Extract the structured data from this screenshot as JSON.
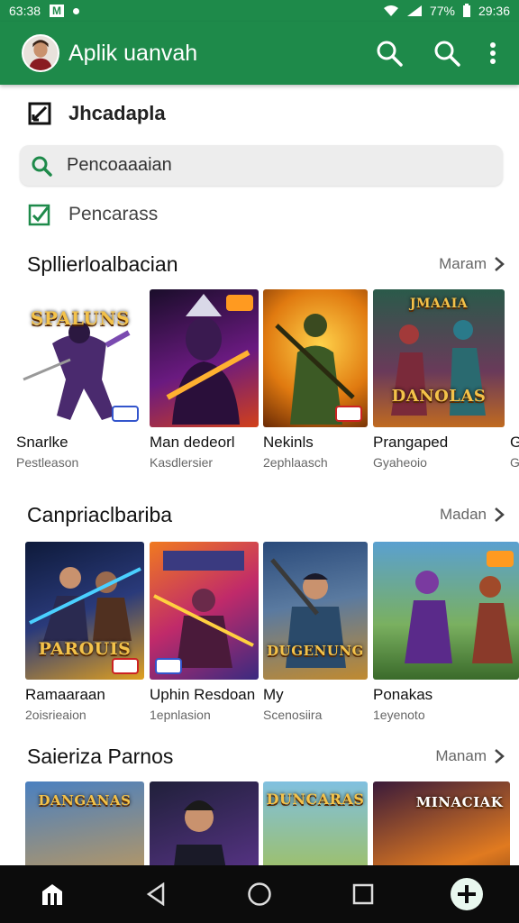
{
  "status_bar": {
    "time_left": "63:38",
    "battery": "77%",
    "time_right": "29:36"
  },
  "app_bar": {
    "title": "Aplik uanvah"
  },
  "menu": {
    "header_label": "Jhcadapla",
    "search_placeholder": "Pencoaaaian",
    "item_label": "Pencarass"
  },
  "sections": [
    {
      "title": "Spllierloalbacian",
      "more": "Maram",
      "cards": [
        {
          "name": "Snarlke",
          "sub": "Pestleason",
          "art": "SPALUNS"
        },
        {
          "name": "Man dedeorl",
          "sub": "Kasdlersier",
          "art": ""
        },
        {
          "name": "Nekinls",
          "sub": "2ephlaasch",
          "art": ""
        },
        {
          "name": "Prangaped",
          "sub": "Gyaheoio",
          "art": "DANOLAS"
        },
        {
          "name": "G",
          "sub": "G",
          "art": ""
        }
      ]
    },
    {
      "title": "Canpriaclbariba",
      "more": "Madan",
      "cards": [
        {
          "name": "Ramaaraan",
          "sub": "2oisrieaion",
          "art": "PAROUIS"
        },
        {
          "name": "Uphin Resdoan",
          "sub": "1epnlasion",
          "art": ""
        },
        {
          "name": "My",
          "sub": "Scenosiira",
          "art": "DUGENUNG"
        },
        {
          "name": "Ponakas",
          "sub": "1eyenoto",
          "art": ""
        }
      ]
    },
    {
      "title": "Saieriza Parnos",
      "more": "Manam",
      "cards": [
        {
          "name": "",
          "sub": "",
          "art": "DANGANAS"
        },
        {
          "name": "",
          "sub": "",
          "art": ""
        },
        {
          "name": "",
          "sub": "",
          "art": "DUNCARAS"
        },
        {
          "name": "",
          "sub": "",
          "art": "MINACIAK"
        }
      ]
    }
  ],
  "colors": {
    "accent": "#1e8a4a",
    "nav_bg": "#0c0c0c"
  }
}
